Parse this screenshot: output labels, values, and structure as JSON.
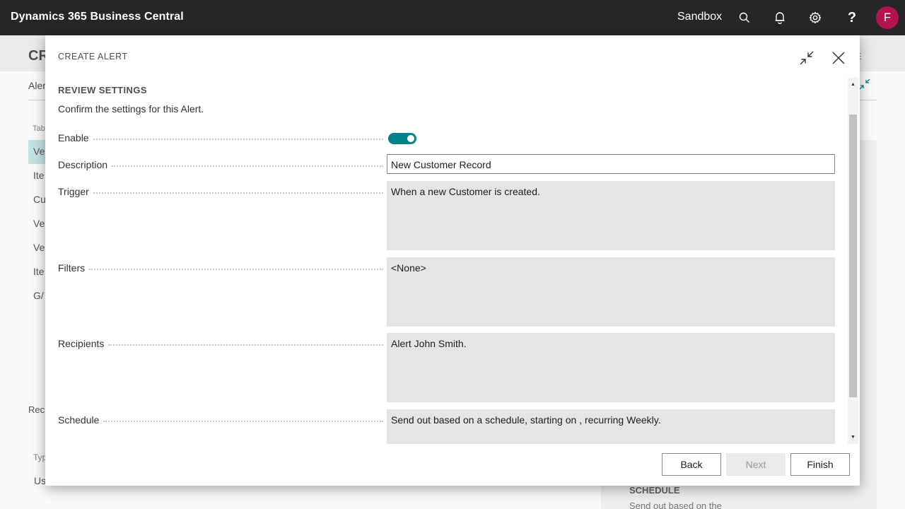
{
  "topbar": {
    "app_title": "Dynamics 365 Business Central",
    "environment": "Sandbox",
    "avatar_initial": "F",
    "icons": [
      "search-icon",
      "bell-icon",
      "gear-icon",
      "help-icon"
    ],
    "colors": {
      "bar": "#262626",
      "avatar": "#b4134f"
    }
  },
  "background_page": {
    "title": "CR",
    "title_tail": "E",
    "subheader": "Aler",
    "column_header": "Tab",
    "rows": [
      "Ve",
      "Ite",
      "Cu",
      "Ve",
      "Ve",
      "Ite",
      "G/"
    ],
    "recipients_label": "Reci",
    "type_header": "Typ",
    "type_value": "Us",
    "schedule_heading": "SCHEDULE",
    "schedule_text": "Send out based on the"
  },
  "dialog": {
    "title": "CREATE ALERT",
    "section_title": "REVIEW SETTINGS",
    "section_description": "Confirm the settings for this Alert.",
    "fields": {
      "enable": {
        "label": "Enable",
        "value": true
      },
      "description": {
        "label": "Description",
        "value": "New Customer Record"
      },
      "trigger": {
        "label": "Trigger",
        "value": "When a new Customer is created."
      },
      "filters": {
        "label": "Filters",
        "value": "<None>"
      },
      "recipients": {
        "label": "Recipients",
        "value": "Alert John Smith."
      },
      "schedule": {
        "label": "Schedule",
        "value": "Send out based on a schedule, starting on , recurring Weekly."
      }
    },
    "buttons": {
      "back": "Back",
      "next": "Next",
      "finish": "Finish"
    },
    "colors": {
      "accent": "#008489",
      "readonly_bg": "#e4e5e7"
    }
  }
}
